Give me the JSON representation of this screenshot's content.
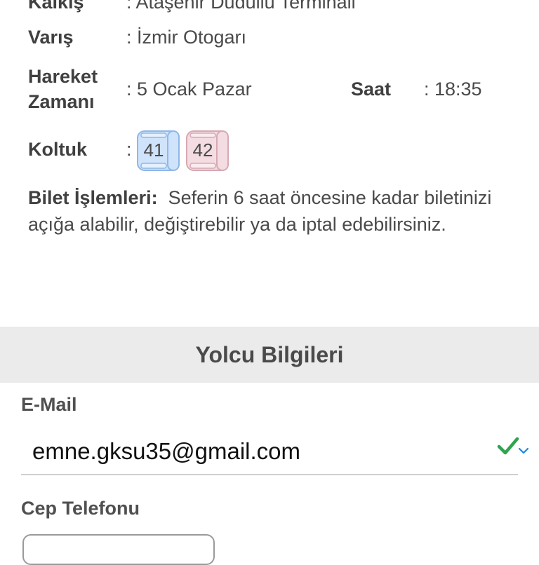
{
  "trip": {
    "departure_label": "Kalkış",
    "departure_value": ": Ataşehir Dudullu Terminali",
    "arrival_label": "Varış",
    "arrival_value": ": İzmir Otogarı",
    "time_label_line1": "Hareket",
    "time_label_line2": "Zamanı",
    "time_value": ": 5 Ocak Pazar",
    "hour_label": "Saat",
    "hour_value": ": 18:35",
    "seat_label": "Koltuk",
    "seat_colon": ":",
    "seats": [
      {
        "number": "41",
        "color": "#cfe3fb",
        "stroke": "#8fb7e8"
      },
      {
        "number": "42",
        "color": "#f4dde2",
        "stroke": "#d6a9b3"
      }
    ]
  },
  "ticket_ops": {
    "label": "Bilet İşlemleri:",
    "text": "Seferin 6 saat öncesine kadar biletinizi açığa alabilir, değiştirebilir ya da iptal edebilirsiniz."
  },
  "passenger": {
    "section_title": "Yolcu Bilgileri",
    "email_label": "E-Mail",
    "email_value": "emne.gksu35@gmail.com",
    "phone_label": "Cep Telefonu"
  },
  "icons": {
    "check": "check-icon",
    "chevron": "chevron-down-icon"
  },
  "colors": {
    "check": "#2ea44f",
    "chevron": "#1e88e5",
    "section_bg": "#ebebeb"
  }
}
